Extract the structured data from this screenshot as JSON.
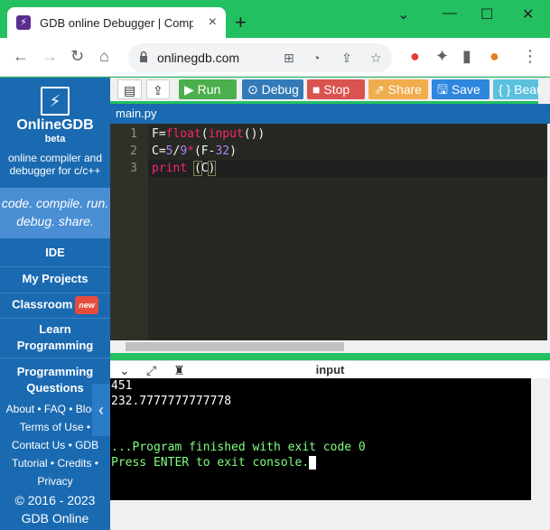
{
  "browser": {
    "tab_title": "GDB online Debugger | Compile",
    "tab_close": "×",
    "new_tab": "+",
    "window_buttons": [
      "⌄",
      "—",
      "☐",
      "✕"
    ],
    "url": "onlinegdb.com"
  },
  "sidebar": {
    "brand": "OnlineGDB",
    "brand_sub": "beta",
    "tagline": "online compiler and debugger for c/c++",
    "motto": "code. compile. run. debug. share.",
    "items": [
      {
        "label": "IDE"
      },
      {
        "label": "My Projects"
      },
      {
        "label": "Classroom",
        "badge": "new"
      },
      {
        "label": "Learn Programming"
      },
      {
        "label": "Programming Questions"
      }
    ],
    "footer_links": [
      "About • FAQ • Blog •",
      "Terms of Use •",
      "Contact Us • GDB",
      "Tutorial • Credits •",
      "Privacy"
    ],
    "copyright": "© 2016 - 2023",
    "company": "GDB Online"
  },
  "toolbar": {
    "run": "Run",
    "debug": "Debug",
    "stop": "Stop",
    "share": "Share",
    "save": "Save",
    "beautify": "{ } Beaut",
    "colors": {
      "run": "#4cae4c",
      "debug": "#337ab7",
      "stop": "#d9534f",
      "share": "#f0ad4e",
      "save": "#2e86de",
      "beautify": "#5bc0de"
    }
  },
  "editor": {
    "file_tab": "main.py",
    "lines": [
      "1",
      "2",
      "3"
    ],
    "code": {
      "line1_a": "F=",
      "line1_b": "float",
      "line1_c": "(",
      "line1_d": "input",
      "line1_e": "())",
      "line2_a": "C=",
      "line2_b": "5",
      "line2_c": "/",
      "line2_d": "9",
      "line2_e": "*",
      "line2_f": "(F-",
      "line2_g": "32",
      "line2_h": ")",
      "line3_a": "print ",
      "line3_b": "(",
      "line3_c": "C",
      "line3_d": ")"
    }
  },
  "console": {
    "label": "input",
    "lines": [
      "451",
      "232.7777777777778",
      "",
      "",
      "...Program finished with exit code 0",
      "Press ENTER to exit console."
    ]
  }
}
